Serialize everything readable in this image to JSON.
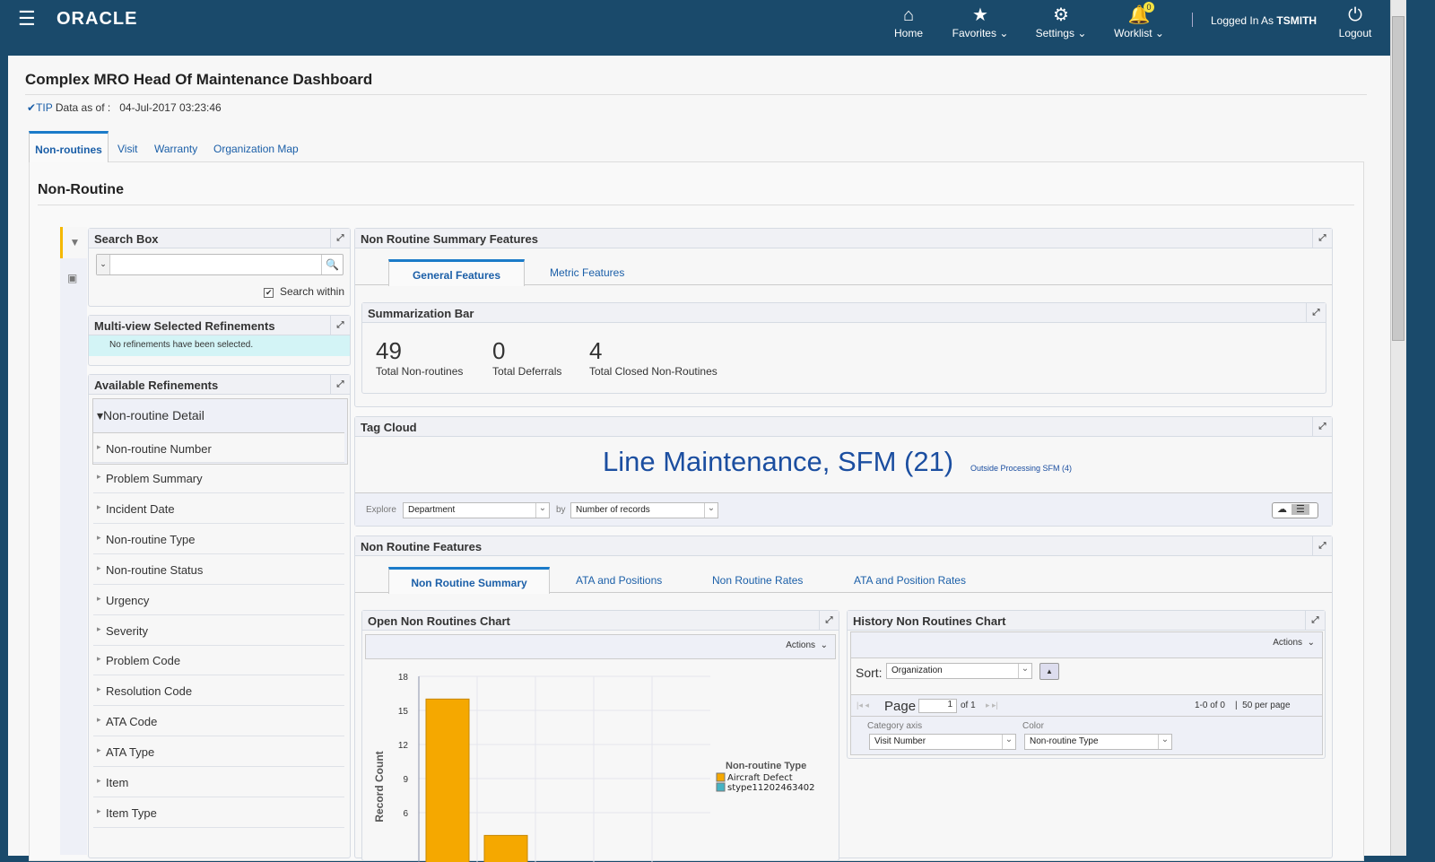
{
  "header": {
    "brand": "ORACLE",
    "nav": [
      {
        "label": "Home",
        "icon": "home-icon"
      },
      {
        "label": "Favorites",
        "icon": "star-icon"
      },
      {
        "label": "Settings",
        "icon": "gear-icon"
      },
      {
        "label": "Worklist",
        "icon": "bell-icon",
        "badge": "0"
      }
    ],
    "logged_in_prefix": "Logged In As",
    "user": "TSMITH",
    "logout": "Logout"
  },
  "page": {
    "title": "Complex MRO Head Of Maintenance Dashboard",
    "tip": "TIP",
    "data_as_of_label": "Data as of :",
    "data_as_of": "04-Jul-2017 03:23:46"
  },
  "tabs": [
    {
      "label": "Non-routines",
      "selected": true
    },
    {
      "label": "Visit"
    },
    {
      "label": "Warranty"
    },
    {
      "label": "Organization Map"
    }
  ],
  "section_title": "Non-Routine",
  "search_box": {
    "title": "Search Box",
    "value": "",
    "search_within": "Search within",
    "search_within_checked": true
  },
  "selected_refinements": {
    "title": "Multi-view Selected Refinements",
    "message": "No refinements have been selected."
  },
  "available_refinements": {
    "title": "Available Refinements",
    "group": "Non-routine Detail",
    "items": [
      "Non-routine Number",
      "Problem Summary",
      "Incident Date",
      "Non-routine Type",
      "Non-routine Status",
      "Urgency",
      "Severity",
      "Problem Code",
      "Resolution Code",
      "ATA Code",
      "ATA Type",
      "Item",
      "Item Type"
    ]
  },
  "summary_features": {
    "title": "Non Routine Summary Features",
    "tabs": [
      "General Features",
      "Metric Features"
    ],
    "bar_title": "Summarization Bar",
    "metrics": [
      {
        "value": "49",
        "label": "Total Non-routines"
      },
      {
        "value": "0",
        "label": "Total Deferrals"
      },
      {
        "value": "4",
        "label": "Total Closed Non-Routines"
      }
    ]
  },
  "tag_cloud": {
    "title": "Tag Cloud",
    "tags": [
      {
        "label": "Line Maintenance, SFM (21)"
      },
      {
        "label": "Outside Processing SFM (4)"
      }
    ],
    "explore_label": "Explore",
    "explore_value": "Department",
    "by_label": "by",
    "by_value": "Number of records"
  },
  "features": {
    "title": "Non Routine Features",
    "tabs": [
      "Non Routine Summary",
      "ATA and Positions",
      "Non Routine Rates",
      "ATA and Position Rates"
    ]
  },
  "open_chart": {
    "title": "Open Non Routines Chart",
    "actions": "Actions"
  },
  "history_chart": {
    "title": "History Non Routines Chart",
    "actions": "Actions",
    "sort_label": "Sort:",
    "sort_value": "Organization",
    "page_label": "Page",
    "page_value": "1",
    "of": "of 1",
    "range": "1-0 of 0",
    "per_page": "50 per page",
    "category_label": "Category axis",
    "category_value": "Visit Number",
    "color_label": "Color",
    "color_value": "Non-routine Type"
  },
  "chart_data": {
    "type": "bar",
    "ylabel": "Record Count",
    "yticks": [
      6,
      9,
      12,
      15,
      18
    ],
    "ylim": [
      0,
      18
    ],
    "grid": true,
    "legend_title": "Non-routine Type",
    "legend_position": "right",
    "legend": [
      {
        "name": "Aircraft Defect",
        "color": "#f5a800"
      },
      {
        "name": "stype11202463402",
        "color": "#45b3c4"
      }
    ],
    "values": [
      16,
      4
    ],
    "bar_colors": [
      "#f5a800",
      "#f5a800"
    ]
  }
}
